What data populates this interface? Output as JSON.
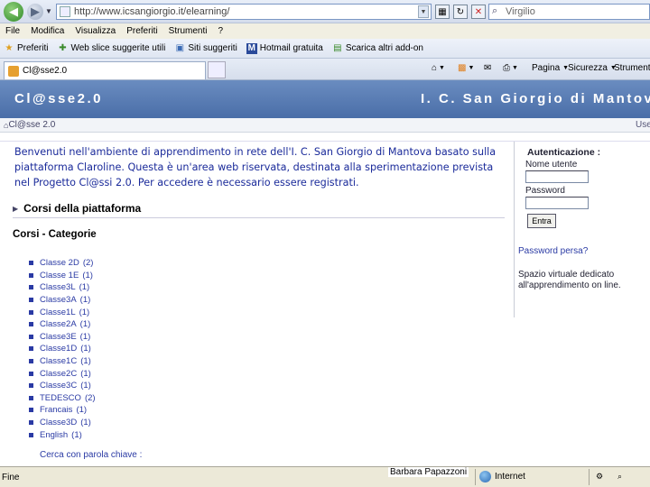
{
  "browser": {
    "address": "http://www.icsangiorgio.it/elearning/",
    "search_placeholder": "Virgilio",
    "menu": [
      "File",
      "Modifica",
      "Visualizza",
      "Preferiti",
      "Strumenti",
      "?"
    ],
    "favorites": [
      {
        "label": "Preferiti",
        "icon": "star-icon"
      },
      {
        "label": "Web slice suggerite utili",
        "icon": "feed-icon"
      },
      {
        "label": "Siti suggeriti",
        "icon": "sites-icon"
      },
      {
        "label": "Hotmail gratuita",
        "icon": "msn-icon"
      },
      {
        "label": "Scarica altri add-on",
        "icon": "addon-icon"
      }
    ],
    "tab_title": "Cl@sse2.0",
    "commands": [
      "Pagina",
      "Sicurezza",
      "Strumenti"
    ]
  },
  "site": {
    "title_left": "Cl@sse2.0",
    "title_right": "I. C. San Giorgio di Mantova",
    "breadcrumb": "Cl@sse 2.0",
    "breadcrumb_user": "Use",
    "welcome": "Benvenuti nell'ambiente di apprendimento in rete dell'I. C. San Giorgio di Mantova basato sulla piattaforma Claroline. Questa è un'area web riservata, destinata alla sperimentazione prevista nel Progetto Cl@ssi 2.0. Per accedere è necessario essere registrati.",
    "section_title": "Corsi della piattaforma",
    "categories_title": "Corsi - Categorie",
    "categories": [
      {
        "name": "Classe 2D",
        "count": "(2)"
      },
      {
        "name": "Classe 1E",
        "count": "(1)"
      },
      {
        "name": "Classe3L",
        "count": "(1)"
      },
      {
        "name": "Classe3A",
        "count": "(1)"
      },
      {
        "name": "Classe1L",
        "count": "(1)"
      },
      {
        "name": "Classe2A",
        "count": "(1)"
      },
      {
        "name": "Classe3E",
        "count": "(1)"
      },
      {
        "name": "Classe1D",
        "count": "(1)"
      },
      {
        "name": "Classe1C",
        "count": "(1)"
      },
      {
        "name": "Classe2C",
        "count": "(1)"
      },
      {
        "name": "Classe3C",
        "count": "(1)"
      },
      {
        "name": "TEDESCO",
        "count": "(2)"
      },
      {
        "name": "Francais",
        "count": "(1)"
      },
      {
        "name": "Classe3D",
        "count": "(1)"
      },
      {
        "name": "English",
        "count": "(1)"
      }
    ],
    "search_keyword": "Cerca con parola chiave :"
  },
  "auth": {
    "title": "Autenticazione :",
    "username_label": "Nome utente",
    "password_label": "Password",
    "enter_label": "Entra",
    "lost_password": "Password persa?",
    "description": "Spazio virtuale dedicato all'apprendimento on line."
  },
  "status": {
    "text": "Fine",
    "author": "Barbara Papazzoni",
    "zone": "Internet"
  }
}
